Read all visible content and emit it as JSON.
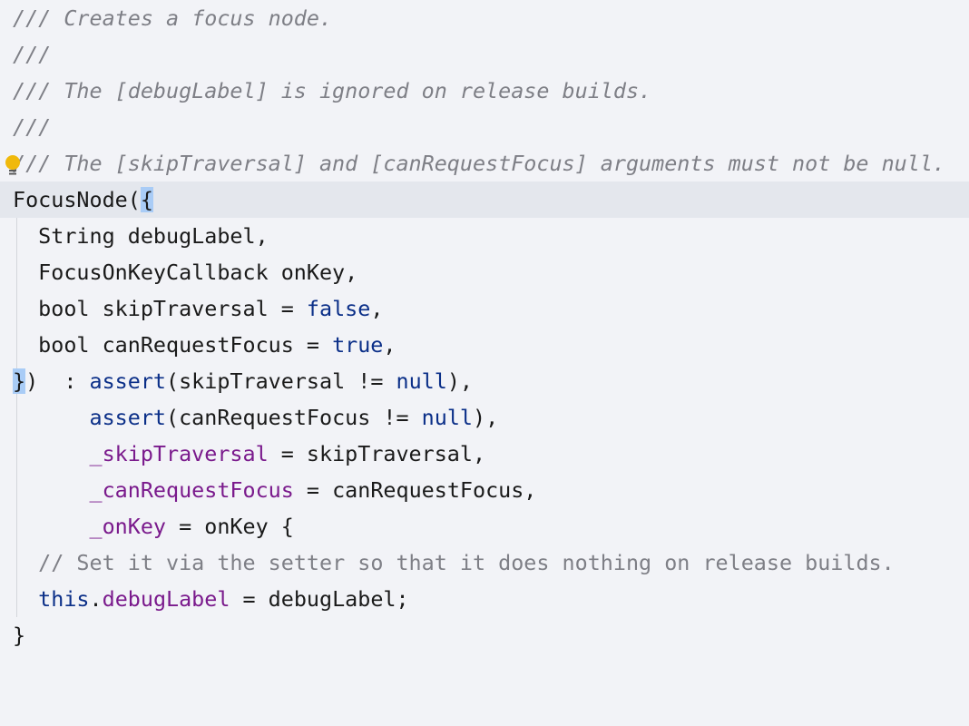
{
  "editor": {
    "language": "Dart",
    "lines": [
      {
        "kind": "doc",
        "text": "/// Creates a focus node."
      },
      {
        "kind": "doc",
        "text": "///"
      },
      {
        "kind": "doc",
        "text": "/// The [debugLabel] is ignored on release builds."
      },
      {
        "kind": "doc",
        "text": "///"
      },
      {
        "kind": "doc",
        "text": "/// The [skipTraversal] and [canRequestFocus] arguments must not be null."
      },
      {
        "kind": "code",
        "parts": {
          "a": "FocusNode(",
          "brace": "{"
        }
      },
      {
        "kind": "code",
        "parts": {
          "a": "  String debugLabel,"
        }
      },
      {
        "kind": "code",
        "parts": {
          "a": "  FocusOnKeyCallback onKey,"
        }
      },
      {
        "kind": "code",
        "parts": {
          "a": "  bool skipTraversal = ",
          "kw": "false",
          "b": ","
        }
      },
      {
        "kind": "code",
        "parts": {
          "a": "  bool canRequestFocus = ",
          "kw": "true",
          "b": ","
        }
      },
      {
        "kind": "code",
        "parts": {
          "brace": "}",
          "a": ")  : ",
          "kw1": "assert",
          "b": "(skipTraversal != ",
          "kw2": "null",
          "c": "),"
        }
      },
      {
        "kind": "code",
        "parts": {
          "a": "      ",
          "kw1": "assert",
          "b": "(canRequestFocus != ",
          "kw2": "null",
          "c": "),"
        }
      },
      {
        "kind": "code",
        "parts": {
          "a": "      ",
          "field": "_skipTraversal",
          "b": " = skipTraversal,"
        }
      },
      {
        "kind": "code",
        "parts": {
          "a": "      ",
          "field": "_canRequestFocus",
          "b": " = canRequestFocus,"
        }
      },
      {
        "kind": "code",
        "parts": {
          "a": "      ",
          "field": "_onKey",
          "b": " = onKey {"
        }
      },
      {
        "kind": "comment",
        "parts": {
          "a": "  ",
          "comment": "// Set it via the setter so that it does nothing on release builds."
        }
      },
      {
        "kind": "code",
        "parts": {
          "a": "  ",
          "kw": "this",
          "b": ".",
          "field": "debugLabel",
          "c": " = debugLabel;"
        }
      },
      {
        "kind": "code",
        "parts": {
          "a": "}"
        }
      }
    ],
    "colors": {
      "background": "#f2f3f7",
      "current_line": "#e4e7ed",
      "comment": "#7e7f86",
      "keyword": "#0b2f88",
      "field": "#7a1a8c",
      "brace_highlight": "#a9ccf6",
      "bulb": "#f0b90b"
    },
    "icons": {
      "intention_bulb": "lightbulb-icon"
    }
  }
}
